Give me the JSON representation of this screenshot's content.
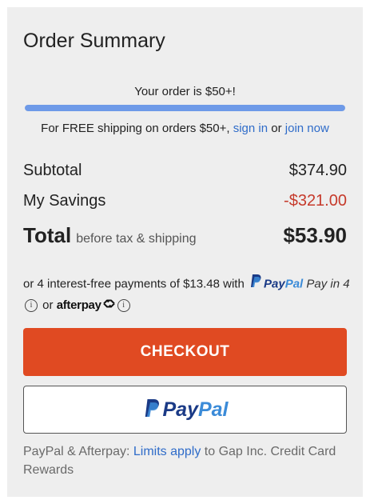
{
  "summary": {
    "title": "Order Summary",
    "threshold_message": "Your order is $50+!",
    "progress_fraction": 1.0,
    "progress_color": "#6e9ae8",
    "shipping": {
      "prefix": "For FREE shipping on orders $50+, ",
      "sign_in_link": "sign in",
      "middle": " or ",
      "join_link": "join now"
    },
    "subtotal": {
      "label": "Subtotal",
      "value": "$374.90"
    },
    "savings": {
      "label": "My Savings",
      "value": "-$321.00",
      "color": "#c63a2b"
    },
    "total": {
      "label": "Total",
      "note": "before tax & shipping",
      "value": "$53.90"
    }
  },
  "installments": {
    "text": "or 4 interest-free payments of $13.48 with",
    "paypal_pay": "Pay",
    "paypal_pal": "Pal",
    "pay_in_4": "Pay in 4",
    "info_glyph": "i",
    "or_text": "or",
    "afterpay_word": "afterpay"
  },
  "buttons": {
    "checkout_label": "CHECKOUT",
    "checkout_color": "#e04a22",
    "paypal_pay": "Pay",
    "paypal_pal": "Pal"
  },
  "footer": {
    "prefix": "PayPal & Afterpay: ",
    "link": "Limits apply",
    "suffix": " to Gap Inc. Credit Card Rewards"
  },
  "icons": [
    "paypal-icon",
    "info-icon",
    "afterpay-icon"
  ]
}
